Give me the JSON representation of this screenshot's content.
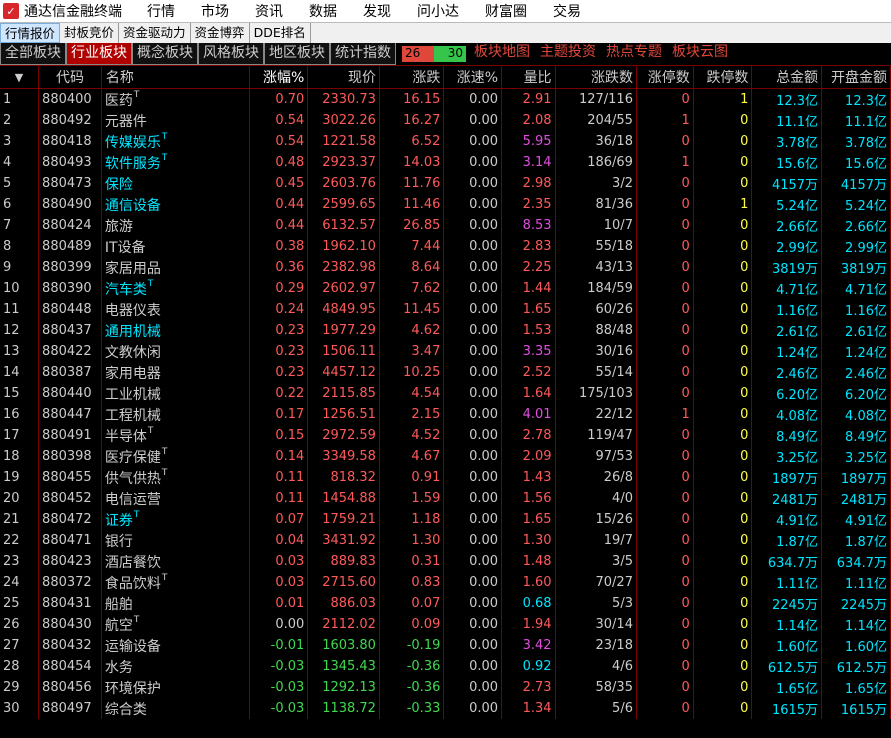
{
  "app": {
    "title": "通达信金融终端",
    "logo_icon": "tdx-logo-icon"
  },
  "menu": [
    "行情",
    "市场",
    "资讯",
    "数据",
    "发现",
    "问小达",
    "财富圈",
    "交易"
  ],
  "subtabs": [
    "行情报价",
    "封板竞价",
    "资金驱动力",
    "资金博弈",
    "DDE排名"
  ],
  "subtabs_active": 0,
  "sector_tabs": [
    "全部板块",
    "行业板块",
    "概念板块",
    "风格板块",
    "地区板块",
    "统计指数"
  ],
  "sector_active": 1,
  "ratio": {
    "up": "26",
    "down": "30"
  },
  "links": [
    "板块地图",
    "主题投资",
    "热点专题",
    "板块云图"
  ],
  "columns": [
    "",
    "代码",
    "名称",
    "涨幅%",
    "现价",
    "涨跌",
    "涨速%",
    "量比",
    "涨跌数",
    "涨停数",
    "跌停数",
    "总金额",
    "开盘金额"
  ],
  "rows": [
    [
      "1",
      "880400",
      "医药",
      true,
      "0.70",
      "2330.73",
      "16.15",
      "0.00",
      "2.91",
      "127/116",
      "0",
      "1",
      "12.3亿",
      "12.3亿"
    ],
    [
      "2",
      "880492",
      "元器件",
      false,
      "0.54",
      "3022.26",
      "16.27",
      "0.00",
      "2.08",
      "204/55",
      "1",
      "0",
      "11.1亿",
      "11.1亿"
    ],
    [
      "3",
      "880418",
      "传媒娱乐",
      true,
      "0.54",
      "1221.58",
      "6.52",
      "0.00",
      "5.95",
      "36/18",
      "0",
      "0",
      "3.78亿",
      "3.78亿"
    ],
    [
      "4",
      "880493",
      "软件服务",
      true,
      "0.48",
      "2923.37",
      "14.03",
      "0.00",
      "3.14",
      "186/69",
      "1",
      "0",
      "15.6亿",
      "15.6亿"
    ],
    [
      "5",
      "880473",
      "保险",
      false,
      "0.45",
      "2603.76",
      "11.76",
      "0.00",
      "2.98",
      "3/2",
      "0",
      "0",
      "4157万",
      "4157万"
    ],
    [
      "6",
      "880490",
      "通信设备",
      false,
      "0.44",
      "2599.65",
      "11.46",
      "0.00",
      "2.35",
      "81/36",
      "0",
      "1",
      "5.24亿",
      "5.24亿"
    ],
    [
      "7",
      "880424",
      "旅游",
      false,
      "0.44",
      "6132.57",
      "26.85",
      "0.00",
      "8.53",
      "10/7",
      "0",
      "0",
      "2.66亿",
      "2.66亿"
    ],
    [
      "8",
      "880489",
      "IT设备",
      false,
      "0.38",
      "1962.10",
      "7.44",
      "0.00",
      "2.83",
      "55/18",
      "0",
      "0",
      "2.99亿",
      "2.99亿"
    ],
    [
      "9",
      "880399",
      "家居用品",
      false,
      "0.36",
      "2382.98",
      "8.64",
      "0.00",
      "2.25",
      "43/13",
      "0",
      "0",
      "3819万",
      "3819万"
    ],
    [
      "10",
      "880390",
      "汽车类",
      true,
      "0.29",
      "2602.97",
      "7.62",
      "0.00",
      "1.44",
      "184/59",
      "0",
      "0",
      "4.71亿",
      "4.71亿"
    ],
    [
      "11",
      "880448",
      "电器仪表",
      false,
      "0.24",
      "4849.95",
      "11.45",
      "0.00",
      "1.65",
      "60/26",
      "0",
      "0",
      "1.16亿",
      "1.16亿"
    ],
    [
      "12",
      "880437",
      "通用机械",
      false,
      "0.23",
      "1977.29",
      "4.62",
      "0.00",
      "1.53",
      "88/48",
      "0",
      "0",
      "2.61亿",
      "2.61亿"
    ],
    [
      "13",
      "880422",
      "文教休闲",
      false,
      "0.23",
      "1506.11",
      "3.47",
      "0.00",
      "3.35",
      "30/16",
      "0",
      "0",
      "1.24亿",
      "1.24亿"
    ],
    [
      "14",
      "880387",
      "家用电器",
      false,
      "0.23",
      "4457.12",
      "10.25",
      "0.00",
      "2.52",
      "55/14",
      "0",
      "0",
      "2.46亿",
      "2.46亿"
    ],
    [
      "15",
      "880440",
      "工业机械",
      false,
      "0.22",
      "2115.85",
      "4.54",
      "0.00",
      "1.64",
      "175/103",
      "0",
      "0",
      "6.20亿",
      "6.20亿"
    ],
    [
      "16",
      "880447",
      "工程机械",
      false,
      "0.17",
      "1256.51",
      "2.15",
      "0.00",
      "4.01",
      "22/12",
      "1",
      "0",
      "4.08亿",
      "4.08亿"
    ],
    [
      "17",
      "880491",
      "半导体",
      true,
      "0.15",
      "2972.59",
      "4.52",
      "0.00",
      "2.78",
      "119/47",
      "0",
      "0",
      "8.49亿",
      "8.49亿"
    ],
    [
      "18",
      "880398",
      "医疗保健",
      true,
      "0.14",
      "3349.58",
      "4.67",
      "0.00",
      "2.09",
      "97/53",
      "0",
      "0",
      "3.25亿",
      "3.25亿"
    ],
    [
      "19",
      "880455",
      "供气供热",
      true,
      "0.11",
      "818.32",
      "0.91",
      "0.00",
      "1.43",
      "26/8",
      "0",
      "0",
      "1897万",
      "1897万"
    ],
    [
      "20",
      "880452",
      "电信运营",
      false,
      "0.11",
      "1454.88",
      "1.59",
      "0.00",
      "1.56",
      "4/0",
      "0",
      "0",
      "2481万",
      "2481万"
    ],
    [
      "21",
      "880472",
      "证券",
      true,
      "0.07",
      "1759.21",
      "1.18",
      "0.00",
      "1.65",
      "15/26",
      "0",
      "0",
      "4.91亿",
      "4.91亿"
    ],
    [
      "22",
      "880471",
      "银行",
      false,
      "0.04",
      "3431.92",
      "1.30",
      "0.00",
      "1.30",
      "19/7",
      "0",
      "0",
      "1.87亿",
      "1.87亿"
    ],
    [
      "23",
      "880423",
      "酒店餐饮",
      false,
      "0.03",
      "889.83",
      "0.31",
      "0.00",
      "1.48",
      "3/5",
      "0",
      "0",
      "634.7万",
      "634.7万"
    ],
    [
      "24",
      "880372",
      "食品饮料",
      true,
      "0.03",
      "2715.60",
      "0.83",
      "0.00",
      "1.60",
      "70/27",
      "0",
      "0",
      "1.11亿",
      "1.11亿"
    ],
    [
      "25",
      "880431",
      "船舶",
      false,
      "0.01",
      "886.03",
      "0.07",
      "0.00",
      "0.68",
      "5/3",
      "0",
      "0",
      "2245万",
      "2245万"
    ],
    [
      "26",
      "880430",
      "航空",
      true,
      "0.00",
      "2112.02",
      "0.09",
      "0.00",
      "1.94",
      "30/14",
      "0",
      "0",
      "1.14亿",
      "1.14亿"
    ],
    [
      "27",
      "880432",
      "运输设备",
      false,
      "-0.01",
      "1603.80",
      "-0.19",
      "0.00",
      "3.42",
      "23/18",
      "0",
      "0",
      "1.60亿",
      "1.60亿"
    ],
    [
      "28",
      "880454",
      "水务",
      false,
      "-0.03",
      "1345.43",
      "-0.36",
      "0.00",
      "0.92",
      "4/6",
      "0",
      "0",
      "612.5万",
      "612.5万"
    ],
    [
      "29",
      "880456",
      "环境保护",
      false,
      "-0.03",
      "1292.13",
      "-0.36",
      "0.00",
      "2.73",
      "58/35",
      "0",
      "0",
      "1.65亿",
      "1.65亿"
    ],
    [
      "30",
      "880497",
      "综合类",
      false,
      "-0.03",
      "1138.72",
      "-0.33",
      "0.00",
      "1.34",
      "5/6",
      "0",
      "0",
      "1615万",
      "1615万"
    ]
  ],
  "name_colors": {
    "1": "white",
    "2": "white",
    "3": "cyan",
    "4": "cyan",
    "5": "cyan",
    "6": "cyan",
    "7": "white",
    "8": "white",
    "9": "white",
    "10": "cyan",
    "11": "white",
    "12": "cyan",
    "13": "white",
    "14": "white",
    "15": "white",
    "16": "white",
    "17": "white",
    "18": "white",
    "19": "white",
    "20": "white",
    "21": "cyan",
    "22": "white",
    "23": "white",
    "24": "white",
    "25": "white",
    "26": "white",
    "27": "white",
    "28": "white",
    "29": "white",
    "30": "white"
  },
  "colors": {
    "up": "#ff5a5a",
    "down": "#3fd94f",
    "volume": "#00e5ff",
    "highlight": "#e04ee0"
  }
}
